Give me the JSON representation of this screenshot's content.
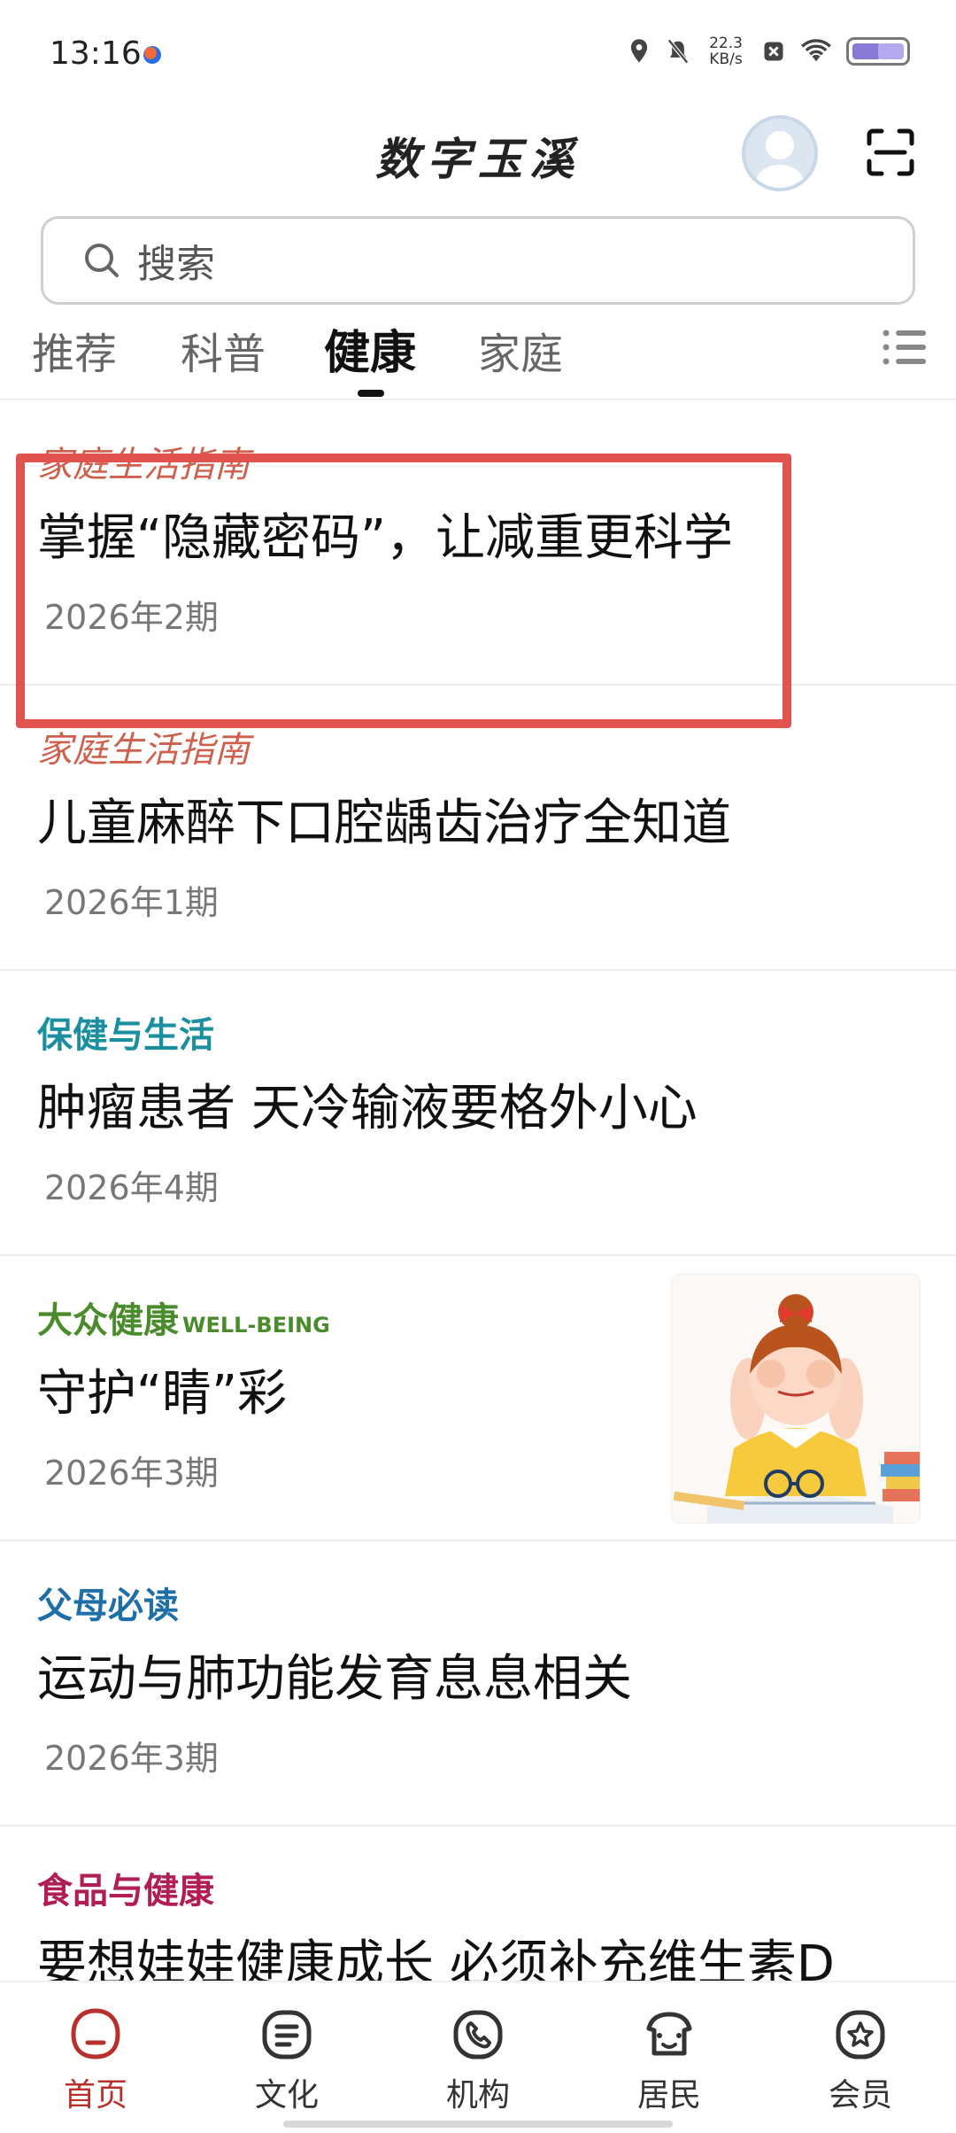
{
  "status_bar": {
    "time": "13:16",
    "net_speed_value": "22.3",
    "net_speed_unit": "KB/s"
  },
  "header": {
    "title": "数字玉溪",
    "icons": [
      "avatar",
      "scan-icon"
    ]
  },
  "search": {
    "placeholder": "搜索"
  },
  "tabs": [
    {
      "label": "推荐",
      "active": false
    },
    {
      "label": "科普",
      "active": false
    },
    {
      "label": "健康",
      "active": true
    },
    {
      "label": "家庭",
      "active": false
    }
  ],
  "articles": [
    {
      "source": "家庭生活指南",
      "title": "掌握“隐藏密码”，让减重更科学",
      "issue": "2026年2期"
    },
    {
      "source": "家庭生活指南",
      "title": "儿童麻醉下口腔龋齿治疗全知道",
      "issue": "2026年1期"
    },
    {
      "source": "保健与生活",
      "title": "肿瘤患者 天冷输液要格外小心",
      "issue": "2026年4期"
    },
    {
      "source": "大众健康",
      "source_sub": "WELL-BEING",
      "title": "守护“睛”彩",
      "issue": "2026年3期",
      "thumbnail": "girl-rubbing-eyes-illustration"
    },
    {
      "source": "父母必读",
      "title": "运动与肺功能发育息息相关",
      "issue": "2026年3期"
    },
    {
      "source": "食品与健康",
      "title": "要想娃娃健康成长 必须补充维生素D"
    }
  ],
  "bottom_nav": [
    {
      "label": "首页",
      "icon": "home-icon",
      "active": true
    },
    {
      "label": "文化",
      "icon": "culture-icon",
      "active": false
    },
    {
      "label": "机构",
      "icon": "phone-icon",
      "active": false
    },
    {
      "label": "居民",
      "icon": "resident-icon",
      "active": false
    },
    {
      "label": "会员",
      "icon": "member-icon",
      "active": false
    }
  ],
  "colors": {
    "highlight": "#e0534f",
    "active_nav": "#b8302a"
  }
}
